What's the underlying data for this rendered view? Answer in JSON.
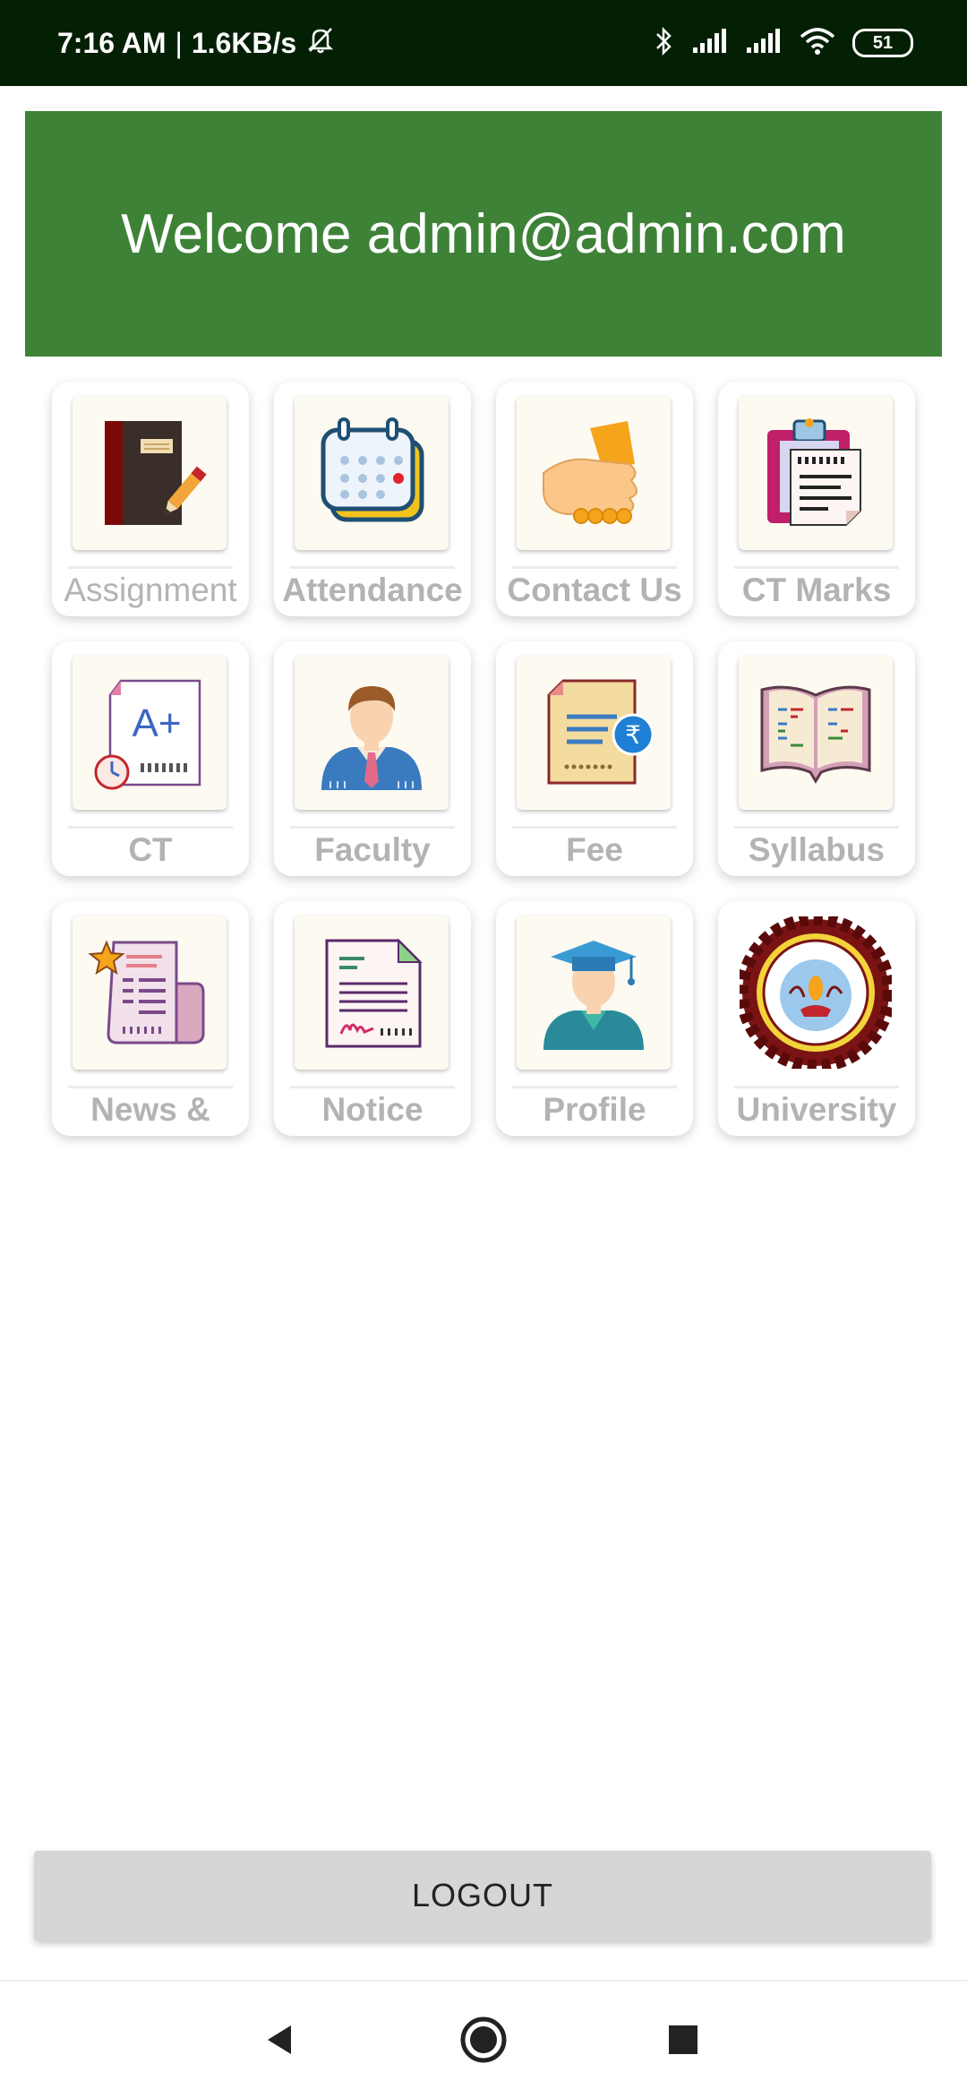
{
  "status_bar": {
    "time": "7:16 AM",
    "separator": "|",
    "speed": "1.6KB/s",
    "battery": "51",
    "icons": [
      "mute-bell-icon",
      "bluetooth-icon",
      "signal-icon",
      "signal-icon",
      "wifi-icon",
      "battery-icon"
    ]
  },
  "header": {
    "welcome_text": "Welcome admin@admin.com",
    "background": "#3e8237"
  },
  "tiles": [
    {
      "label": "Assignment",
      "icon": "notebook-pencil-icon"
    },
    {
      "label": "Attendance",
      "icon": "calendar-icon"
    },
    {
      "label": "Contact Us",
      "icon": "handshake-icon"
    },
    {
      "label": "CT Marks",
      "icon": "clipboard-icon"
    },
    {
      "label": "CT",
      "icon": "grade-paper-icon"
    },
    {
      "label": "Faculty",
      "icon": "teacher-icon"
    },
    {
      "label": "Fee",
      "icon": "rupee-document-icon"
    },
    {
      "label": "Syllabus",
      "icon": "open-book-icon"
    },
    {
      "label": "News &",
      "icon": "newspaper-icon"
    },
    {
      "label": "Notice",
      "icon": "signed-document-icon"
    },
    {
      "label": "Profile",
      "icon": "graduate-icon"
    },
    {
      "label": "University",
      "icon": "university-seal-icon"
    }
  ],
  "logout_label": "LOGOUT",
  "nav": [
    "back-icon",
    "home-icon",
    "recents-icon"
  ]
}
